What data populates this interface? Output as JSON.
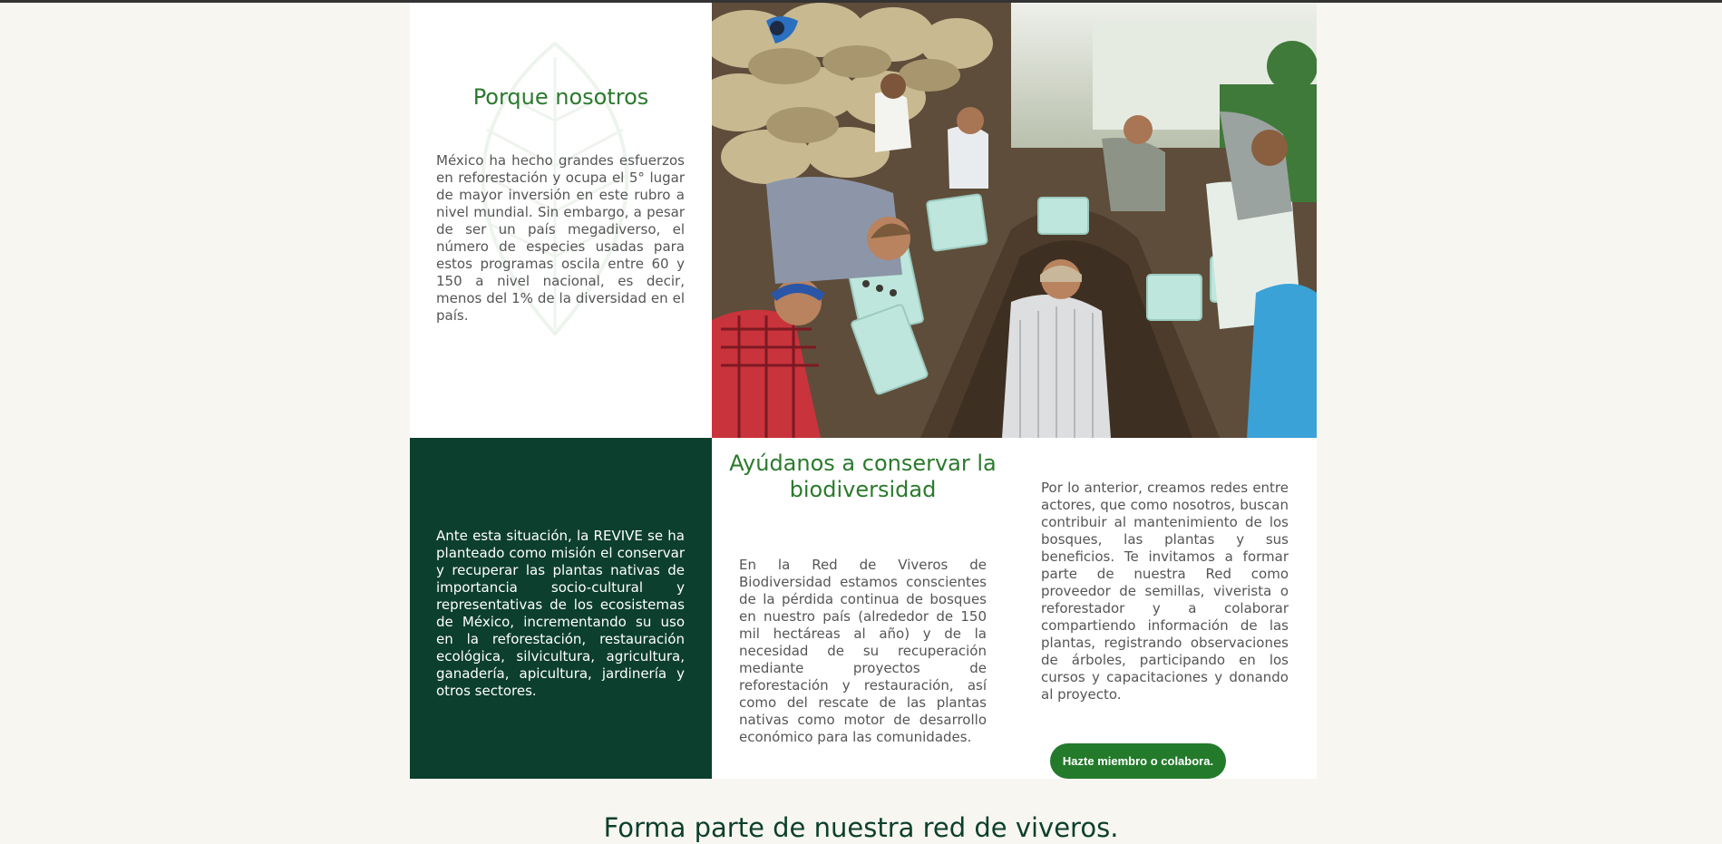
{
  "why": {
    "title": "Porque nosotros",
    "body": "México ha hecho grandes esfuerzos en reforestación y ocupa el 5° lugar de mayor inversión en este rubro a nivel mundial. Sin embargo, a pesar de ser un país megadiverso, el número de especies usadas para estos programas oscila entre 60 y 150 a nivel nacional, es decir, menos del 1% de la diversidad en el país."
  },
  "photo": {
    "alt": "people-planting-seedlings-photo"
  },
  "mission": {
    "body": "Ante esta situación, la REVIVE se ha planteado como misión el conservar y recuperar las plantas nativas de importancia socio-cultural y representativas de los ecosistemas de México, incrementando su uso en la reforestación, restauración ecológica, silvicultura, agricultura, ganadería, apicultura, jardinería y otros sectores."
  },
  "help": {
    "title": "Ayúdanos a conservar la biodiversidad",
    "body": "En la Red de Viveros de Biodiversidad estamos conscientes de la pérdida continua de bosques en nuestro país (alrededor de 150 mil hectáreas al año) y de la necesidad de su recuperación mediante proyectos de reforestación y restauración, así como del rescate de las plantas nativas como motor de desarrollo económico para las comunidades."
  },
  "network": {
    "body": "Por lo anterior, creamos redes entre actores, que como nosotros, buscan contribuir al mantenimiento de los bosques, las plantas y sus beneficios. Te invitamos a formar parte de nuestra Red como proveedor de semillas, viverista o reforestador y a colaborar compartiendo información de las plantas, registrando observaciones de árboles, participando en los cursos y capacitaciones y donando al proyecto.",
    "cta_label": "Hazte miembro o colabora."
  },
  "section": {
    "title": "Forma parte de nuestra red de viveros."
  },
  "colors": {
    "primary_green": "#2a7a2c",
    "dark_green": "#0c3f2d",
    "button_green": "#237a2b",
    "page_bg": "#f8f6f1"
  }
}
